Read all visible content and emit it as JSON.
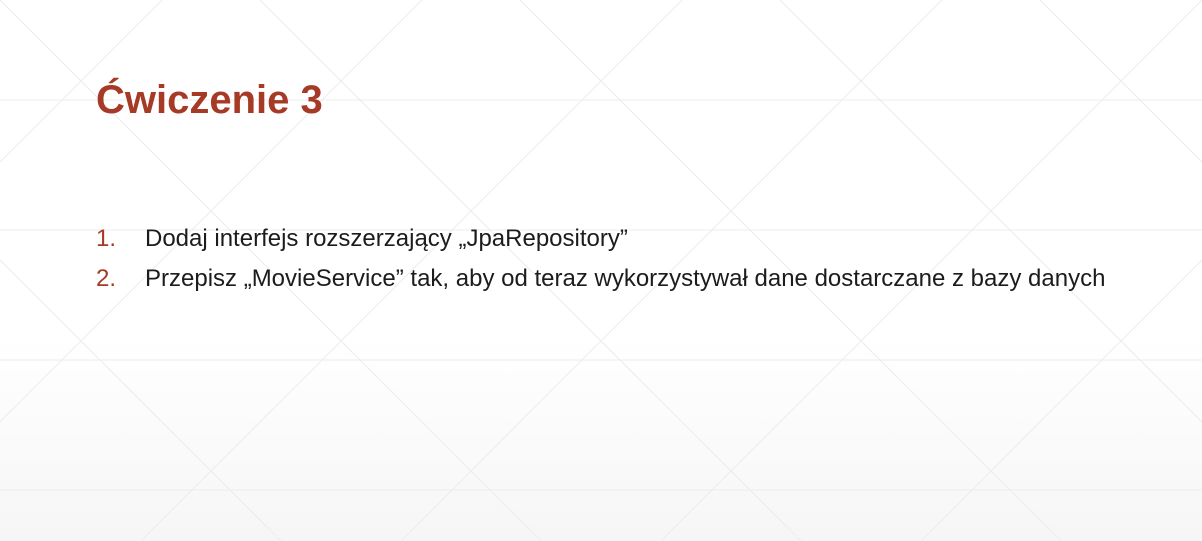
{
  "slide": {
    "title": "Ćwiczenie 3",
    "items": [
      {
        "number": "1.",
        "text": "Dodaj interfejs rozszerzający „JpaRepository”"
      },
      {
        "number": "2.",
        "text": "Przepisz „MovieService” tak, aby od teraz wykorzystywał dane dostarczane z bazy danych"
      }
    ]
  },
  "colors": {
    "accent": "#a63a26",
    "text": "#1c1c1c",
    "background": "#ffffff",
    "pattern_lines": "#ececec"
  }
}
